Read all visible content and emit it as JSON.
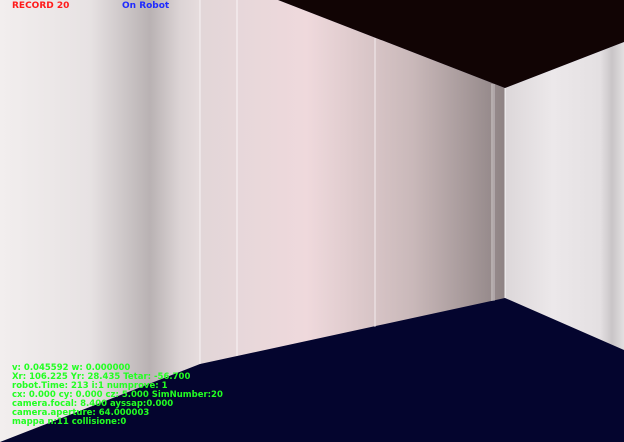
{
  "hud": {
    "record_label": "RECORD 20",
    "mode_label": "On Robot"
  },
  "telemetry": [
    "v: 0.045592 w: 0.000000",
    "Xr: 106.225 Yr: 28.435 Tetar: -56.700",
    "robot.Time: 213 i:1 numprove: 1",
    "cx: 0.000 cy: 0.000 cz: 5.000 SimNumber:20",
    "camera.focal: 8.400 ayssap:0.000",
    "camera.aperture: 64.000003",
    "mappa n:11 collisione:0"
  ],
  "colors": {
    "record": "#ff1a1a",
    "mode": "#1f2bff",
    "telemetry": "#22ff22",
    "floor": "#04052e",
    "ceiling": "#110404"
  }
}
